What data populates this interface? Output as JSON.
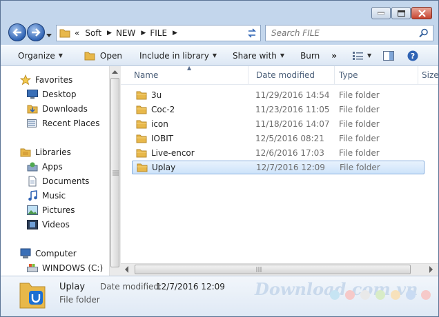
{
  "address": {
    "crumbs": [
      "Soft",
      "NEW",
      "FILE"
    ],
    "overflow_glyph": "«"
  },
  "search": {
    "placeholder": "Search FILE"
  },
  "toolbar": {
    "organize": "Organize",
    "open": "Open",
    "include_in_library": "Include in library",
    "share_with": "Share with",
    "burn": "Burn",
    "more": "»"
  },
  "nav": {
    "favorites": "Favorites",
    "desktop": "Desktop",
    "downloads": "Downloads",
    "recent_places": "Recent Places",
    "libraries": "Libraries",
    "apps": "Apps",
    "documents": "Documents",
    "music": "Music",
    "pictures": "Pictures",
    "videos": "Videos",
    "computer": "Computer",
    "windows_c": "WINDOWS (C:)"
  },
  "columns": {
    "name": "Name",
    "date_modified": "Date modified",
    "type": "Type",
    "size": "Size"
  },
  "files": [
    {
      "name": "3u",
      "date": "11/29/2016 14:54",
      "type": "File folder"
    },
    {
      "name": "Coc-2",
      "date": "11/23/2016 11:05",
      "type": "File folder"
    },
    {
      "name": "icon",
      "date": "11/18/2016 14:07",
      "type": "File folder"
    },
    {
      "name": "IOBIT",
      "date": "12/5/2016 08:21",
      "type": "File folder"
    },
    {
      "name": "Live-encor",
      "date": "12/6/2016 17:03",
      "type": "File folder"
    },
    {
      "name": "Uplay",
      "date": "12/7/2016 12:09",
      "type": "File folder"
    }
  ],
  "details": {
    "name": "Uplay",
    "date_label": "Date modified:",
    "date_value": "12/7/2016 12:09",
    "type": "File folder"
  },
  "watermark": "Download.com.vn",
  "colors": {
    "accent": "#2f63b4",
    "folder": "#e8b84a",
    "selection": "#cde3fa"
  },
  "watermark_dots": [
    "#c6e4f3",
    "#f6c9c9",
    "#e9e9e9",
    "#d8ecc7",
    "#f7e1bb",
    "#c9dbf3",
    "#f6c9c9"
  ]
}
